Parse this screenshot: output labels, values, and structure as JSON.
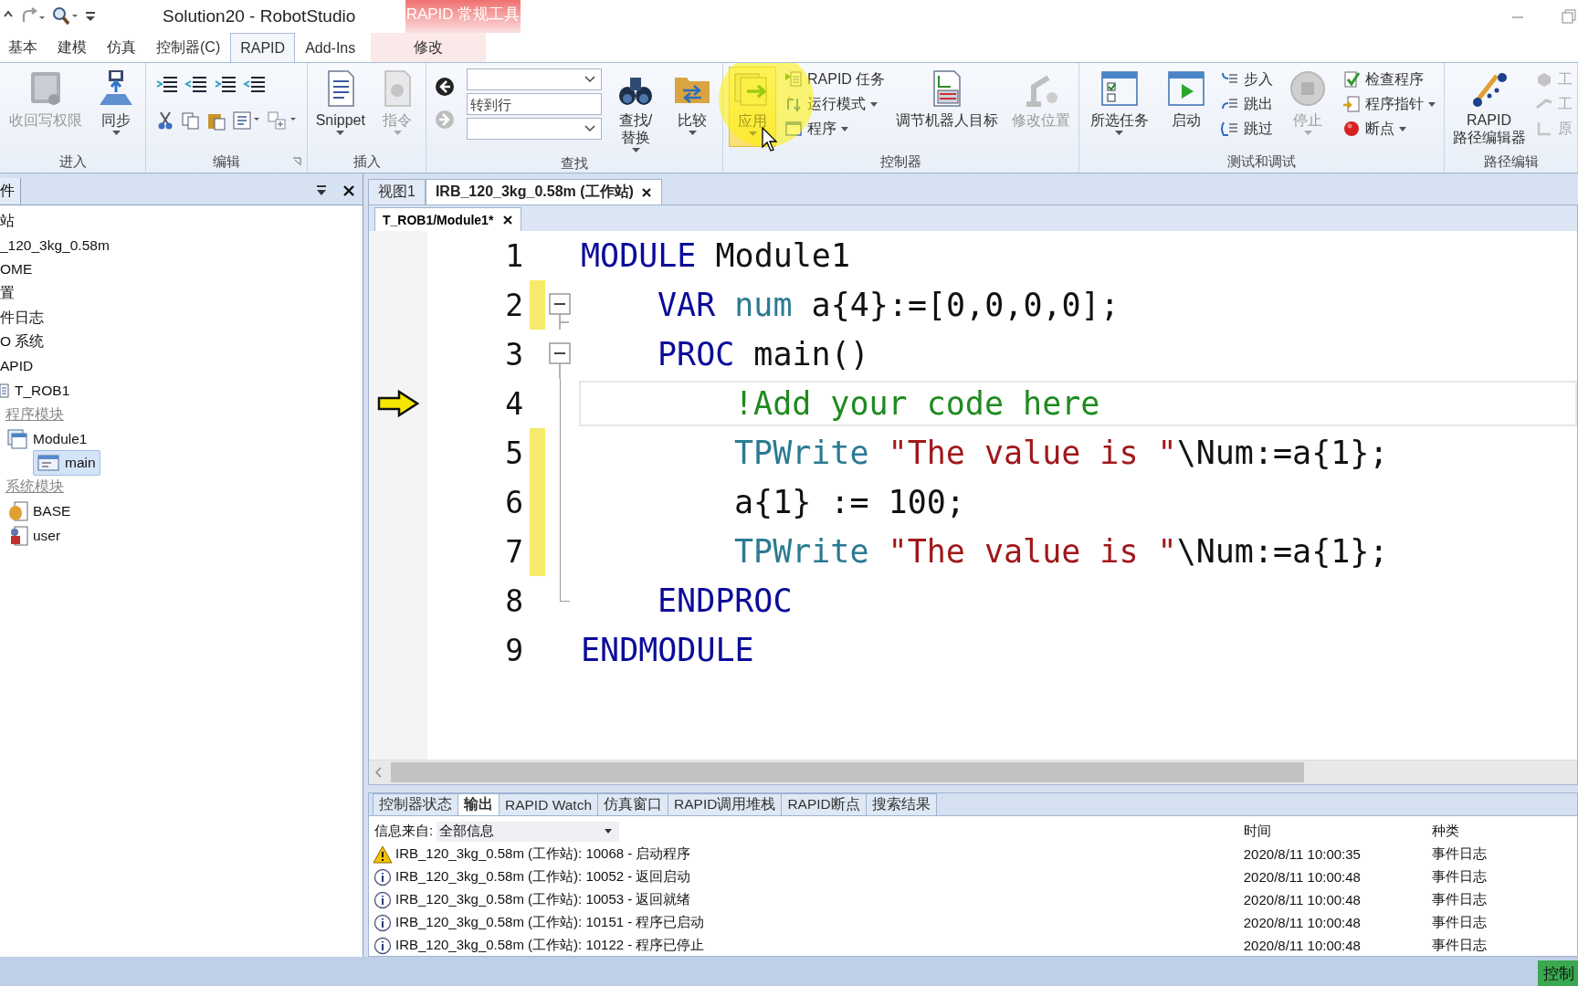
{
  "window": {
    "title": "Solution20 - RobotStudio",
    "context_tab_header": "RAPID 常规工具"
  },
  "tabs": [
    {
      "label": "基本",
      "selected": false,
      "kind": "normal"
    },
    {
      "label": "建模",
      "selected": false,
      "kind": "normal"
    },
    {
      "label": "仿真",
      "selected": false,
      "kind": "normal"
    },
    {
      "label": "控制器(C)",
      "selected": false,
      "kind": "normal"
    },
    {
      "label": "RAPID",
      "selected": true,
      "kind": "normal"
    },
    {
      "label": "Add-Ins",
      "selected": false,
      "kind": "normal"
    },
    {
      "label": "修改",
      "selected": false,
      "kind": "context"
    }
  ],
  "ribbon": {
    "groups": [
      {
        "label": "进入",
        "items": [
          {
            "kind": "large",
            "label": "收回写权限",
            "disabled": true,
            "dropdown": false,
            "pressed": false
          },
          {
            "kind": "large",
            "label": "同步",
            "disabled": false,
            "dropdown": true,
            "pressed": false
          }
        ]
      },
      {
        "label": "编辑",
        "items": [
          {
            "kind": "icons"
          }
        ]
      },
      {
        "label": "插入",
        "items": [
          {
            "kind": "large",
            "label": "Snippet",
            "disabled": false,
            "dropdown": true,
            "pressed": false
          },
          {
            "kind": "large",
            "label": "指令",
            "disabled": true,
            "dropdown": true,
            "pressed": false
          }
        ]
      },
      {
        "label": "查找",
        "items": [
          {
            "kind": "nav",
            "items": [
              {
                "disabled": false
              },
              {
                "disabled": true
              }
            ]
          },
          {
            "kind": "fields",
            "items": [
              {
                "kind": "combo"
              },
              {
                "kind": "text",
                "placeholder": "转到行"
              },
              {
                "kind": "combo"
              }
            ]
          },
          {
            "kind": "large",
            "label": "查找/\n替换",
            "disabled": false,
            "dropdown": true,
            "pressed": false
          },
          {
            "kind": "large",
            "label": "比较",
            "disabled": false,
            "dropdown": true,
            "pressed": false
          }
        ]
      },
      {
        "label": "控制器",
        "items": [
          {
            "kind": "large",
            "label": "应用",
            "disabled": false,
            "dropdown": true,
            "pressed": true
          },
          {
            "kind": "column",
            "items": [
              {
                "label": "RAPID 任务",
                "dropdown": false,
                "disabled": false
              },
              {
                "label": "运行模式",
                "dropdown": true,
                "disabled": false
              },
              {
                "label": "程序",
                "dropdown": true,
                "disabled": false
              }
            ]
          },
          {
            "kind": "large",
            "label": "调节机器人目标",
            "disabled": false,
            "dropdown": false,
            "pressed": false
          },
          {
            "kind": "large",
            "label": "修改位置",
            "disabled": true,
            "dropdown": false,
            "pressed": false
          }
        ]
      },
      {
        "label": "测试和调试",
        "items": [
          {
            "kind": "large",
            "label": "所选任务",
            "disabled": false,
            "dropdown": true,
            "pressed": false
          },
          {
            "kind": "large",
            "label": "启动",
            "disabled": false,
            "dropdown": false,
            "pressed": false
          },
          {
            "kind": "column",
            "items": [
              {
                "label": "步入",
                "dropdown": false,
                "disabled": false
              },
              {
                "label": "跳出",
                "dropdown": false,
                "disabled": false
              },
              {
                "label": "跳过",
                "dropdown": false,
                "disabled": false
              }
            ]
          },
          {
            "kind": "large",
            "label": "停止",
            "disabled": true,
            "dropdown": true,
            "pressed": false
          },
          {
            "kind": "column",
            "items": [
              {
                "label": "检查程序",
                "dropdown": false,
                "disabled": false
              },
              {
                "label": "程序指针",
                "dropdown": true,
                "disabled": false
              },
              {
                "label": "断点",
                "dropdown": true,
                "disabled": false
              }
            ]
          }
        ]
      },
      {
        "label": "路径编辑",
        "items": [
          {
            "kind": "large",
            "label": "RAPID\n路径编辑器",
            "disabled": false,
            "dropdown": false,
            "pressed": false
          },
          {
            "kind": "column",
            "items": [
              {
                "label": "工",
                "dropdown": false,
                "disabled": true
              },
              {
                "label": "工",
                "dropdown": false,
                "disabled": true
              },
              {
                "label": "原",
                "dropdown": false,
                "disabled": true
              }
            ]
          }
        ]
      }
    ]
  },
  "left_panel": {
    "tab": "件",
    "tree": [
      {
        "label": "站",
        "kind": "item",
        "selected": false
      },
      {
        "label": "_120_3kg_0.58m",
        "kind": "item",
        "selected": false
      },
      {
        "label": "OME",
        "kind": "item",
        "selected": false
      },
      {
        "label": "置",
        "kind": "item",
        "selected": false
      },
      {
        "label": "件日志",
        "kind": "item",
        "selected": false
      },
      {
        "label": "O 系统",
        "kind": "item",
        "selected": false
      },
      {
        "label": "APID",
        "kind": "item",
        "selected": false
      },
      {
        "label": "T_ROB1",
        "kind": "task",
        "selected": false,
        "children": [
          {
            "label": "程序模块",
            "kind": "group",
            "selected": false,
            "children": [
              {
                "label": "Module1",
                "kind": "module",
                "selected": false,
                "children": [
                  {
                    "label": "main",
                    "kind": "routine",
                    "selected": true
                  }
                ]
              }
            ]
          },
          {
            "label": "系统模块",
            "kind": "group",
            "selected": false,
            "children": [
              {
                "label": "BASE",
                "kind": "sysmodule",
                "selected": false
              },
              {
                "label": "user",
                "kind": "usermodule",
                "selected": false
              }
            ]
          }
        ]
      }
    ]
  },
  "document_tabs": [
    {
      "label": "视图1",
      "selected": false,
      "closable": false
    },
    {
      "label": "IRB_120_3kg_0.58m (工作站)",
      "selected": true,
      "closable": true
    }
  ],
  "editor_tab": {
    "label": "T_ROB1/Module1*",
    "closable": true
  },
  "code_lines": [
    {
      "number": "1",
      "kind": "module",
      "modified": false,
      "current": false,
      "foldable": false,
      "tokens": [
        {
          "text": "MODULE",
          "kind": "keyword"
        },
        {
          "text": " Module1",
          "kind": "plain"
        }
      ]
    },
    {
      "number": "2",
      "kind": "decl",
      "modified": true,
      "current": false,
      "foldable": true,
      "tokens": [
        {
          "text": "VAR ",
          "kind": "keyword"
        },
        {
          "text": "num",
          "kind": "type"
        },
        {
          "text": " a{4}:=[0,0,0,0];",
          "kind": "plain"
        }
      ]
    },
    {
      "number": "3",
      "kind": "proc",
      "modified": false,
      "current": false,
      "foldable": true,
      "tokens": [
        {
          "text": "PROC",
          "kind": "keyword"
        },
        {
          "text": " main()",
          "kind": "plain"
        }
      ]
    },
    {
      "number": "4",
      "kind": "stmt",
      "modified": false,
      "current": true,
      "foldable": false,
      "tokens": [
        {
          "text": "!Add your code here",
          "kind": "comment"
        }
      ]
    },
    {
      "number": "5",
      "kind": "stmt",
      "modified": true,
      "current": false,
      "foldable": false,
      "tokens": [
        {
          "text": "TPWrite ",
          "kind": "function"
        },
        {
          "text": "\"The value is \"",
          "kind": "string"
        },
        {
          "text": "\\Num:=a{1};",
          "kind": "plain"
        }
      ]
    },
    {
      "number": "6",
      "kind": "stmt",
      "modified": true,
      "current": false,
      "foldable": false,
      "tokens": [
        {
          "text": "a{1} := 100;",
          "kind": "plain"
        }
      ]
    },
    {
      "number": "7",
      "kind": "stmt",
      "modified": true,
      "current": false,
      "foldable": false,
      "tokens": [
        {
          "text": "TPWrite ",
          "kind": "function"
        },
        {
          "text": "\"The value is \"",
          "kind": "string"
        },
        {
          "text": "\\Num:=a{1};",
          "kind": "plain"
        }
      ]
    },
    {
      "number": "8",
      "kind": "endproc",
      "modified": false,
      "current": false,
      "foldable": false,
      "tokens": [
        {
          "text": "ENDPROC",
          "kind": "keyword"
        }
      ]
    },
    {
      "number": "9",
      "kind": "endmodule",
      "modified": false,
      "current": false,
      "foldable": false,
      "tokens": [
        {
          "text": "ENDMODULE",
          "kind": "keyword"
        }
      ]
    }
  ],
  "output_panel": {
    "tabs": [
      {
        "label": "控制器状态",
        "selected": false
      },
      {
        "label": "输出",
        "selected": true
      },
      {
        "label": "RAPID Watch",
        "selected": false
      },
      {
        "label": "仿真窗口",
        "selected": false
      },
      {
        "label": "RAPID调用堆栈",
        "selected": false
      },
      {
        "label": "RAPID断点",
        "selected": false
      },
      {
        "label": "搜索结果",
        "selected": false
      }
    ],
    "filter_label": "信息来自:",
    "filter_value": "全部信息",
    "columns": [
      "时间",
      "种类"
    ],
    "rows": [
      {
        "kind": "warning",
        "message": "IRB_120_3kg_0.58m (工作站): 10068 - 启动程序",
        "time": "2020/8/11 10:00:35",
        "category": "事件日志"
      },
      {
        "kind": "info",
        "message": "IRB_120_3kg_0.58m (工作站): 10052 - 返回启动",
        "time": "2020/8/11 10:00:48",
        "category": "事件日志"
      },
      {
        "kind": "info",
        "message": "IRB_120_3kg_0.58m (工作站): 10053 - 返回就绪",
        "time": "2020/8/11 10:00:48",
        "category": "事件日志"
      },
      {
        "kind": "info",
        "message": "IRB_120_3kg_0.58m (工作站): 10151 - 程序已启动",
        "time": "2020/8/11 10:00:48",
        "category": "事件日志"
      },
      {
        "kind": "info",
        "message": "IRB_120_3kg_0.58m (工作站): 10122 - 程序已停止",
        "time": "2020/8/11 10:00:48",
        "category": "事件日志"
      }
    ]
  },
  "status_bar": {
    "button": "控制"
  }
}
